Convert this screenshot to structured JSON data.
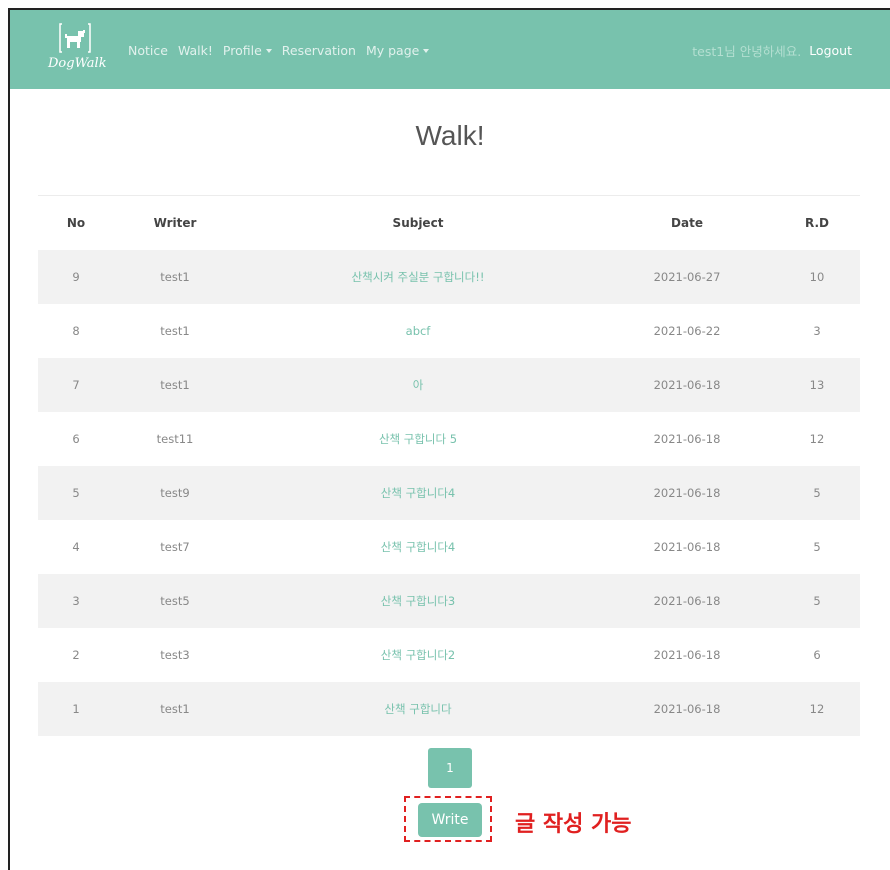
{
  "navbar": {
    "brand": "DogWalk",
    "links": [
      {
        "label": "Notice",
        "dropdown": false
      },
      {
        "label": "Walk!",
        "dropdown": false
      },
      {
        "label": "Profile",
        "dropdown": true
      },
      {
        "label": "Reservation",
        "dropdown": false
      },
      {
        "label": "My page",
        "dropdown": true
      }
    ],
    "greeting": "test1님 안녕하세요.",
    "logout": "Logout",
    "color": "#78c2ad"
  },
  "page_title": "Walk!",
  "table": {
    "headers": {
      "no": "No",
      "writer": "Writer",
      "subject": "Subject",
      "date": "Date",
      "rd": "R.D"
    },
    "rows": [
      {
        "no": "9",
        "writer": "test1",
        "subject": "산책시켜 주실분 구합니다!!",
        "date": "2021-06-27",
        "rd": "10"
      },
      {
        "no": "8",
        "writer": "test1",
        "subject": "abcf",
        "date": "2021-06-22",
        "rd": "3"
      },
      {
        "no": "7",
        "writer": "test1",
        "subject": "아",
        "date": "2021-06-18",
        "rd": "13"
      },
      {
        "no": "6",
        "writer": "test11",
        "subject": "산책 구합니다 5",
        "date": "2021-06-18",
        "rd": "12"
      },
      {
        "no": "5",
        "writer": "test9",
        "subject": "산책 구합니다4",
        "date": "2021-06-18",
        "rd": "5"
      },
      {
        "no": "4",
        "writer": "test7",
        "subject": "산책 구합니다4",
        "date": "2021-06-18",
        "rd": "5"
      },
      {
        "no": "3",
        "writer": "test5",
        "subject": "산책 구합니다3",
        "date": "2021-06-18",
        "rd": "5"
      },
      {
        "no": "2",
        "writer": "test3",
        "subject": "산책 구합니다2",
        "date": "2021-06-18",
        "rd": "6"
      },
      {
        "no": "1",
        "writer": "test1",
        "subject": "산책 구합니다",
        "date": "2021-06-18",
        "rd": "12"
      }
    ]
  },
  "pagination": {
    "current_page": "1"
  },
  "write_button": "Write",
  "annotation": "글 작성 가능",
  "colors": {
    "accent": "#78c2ad",
    "annotation": "#e02020"
  }
}
